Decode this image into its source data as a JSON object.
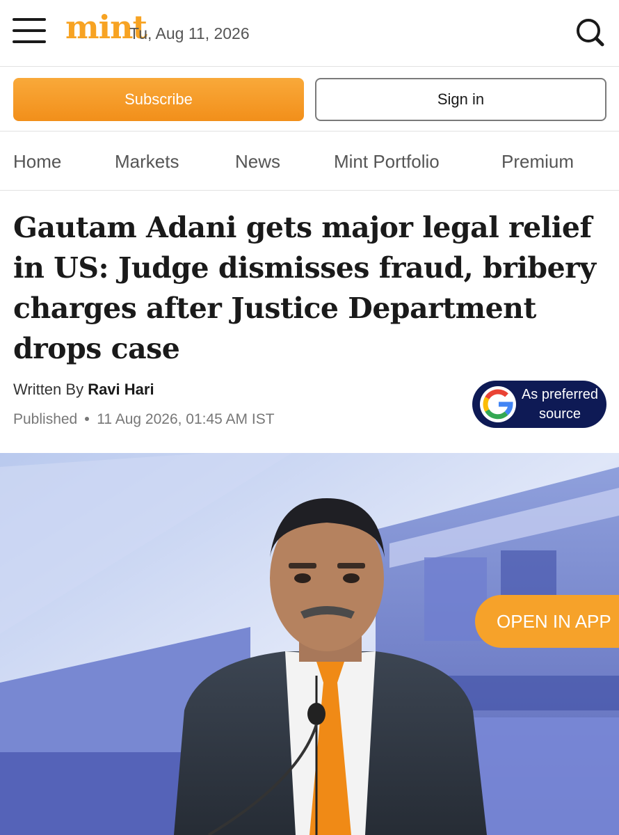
{
  "header": {
    "logo_text": "mint",
    "date": "Tu, Aug 11, 2026",
    "menu_icon": "hamburger-icon",
    "search_icon": "search-icon"
  },
  "auth": {
    "subscribe_label": "Subscribe",
    "signin_label": "Sign in"
  },
  "nav": {
    "items": [
      {
        "label": "Home"
      },
      {
        "label": "Markets"
      },
      {
        "label": "News"
      },
      {
        "label": "Mint Portfolio"
      },
      {
        "label": "Premium"
      }
    ]
  },
  "article": {
    "headline": "Gautam Adani gets major legal relief in US: Judge dismisses fraud, bribery charges after Justice Department drops case",
    "written_by_label": "Written By",
    "author": "Ravi Hari",
    "published_label": "Published",
    "published_time": "11 Aug 2026, 01:45 AM IST"
  },
  "preferred_source": {
    "line1": "As preferred",
    "line2": "source",
    "icon": "google-g-icon"
  },
  "open_app_label": "OPEN IN APP",
  "colors": {
    "brand_orange": "#f7a323",
    "badge_navy": "#0e1a55",
    "text_dark": "#1a1a1a",
    "text_muted": "#777777"
  }
}
